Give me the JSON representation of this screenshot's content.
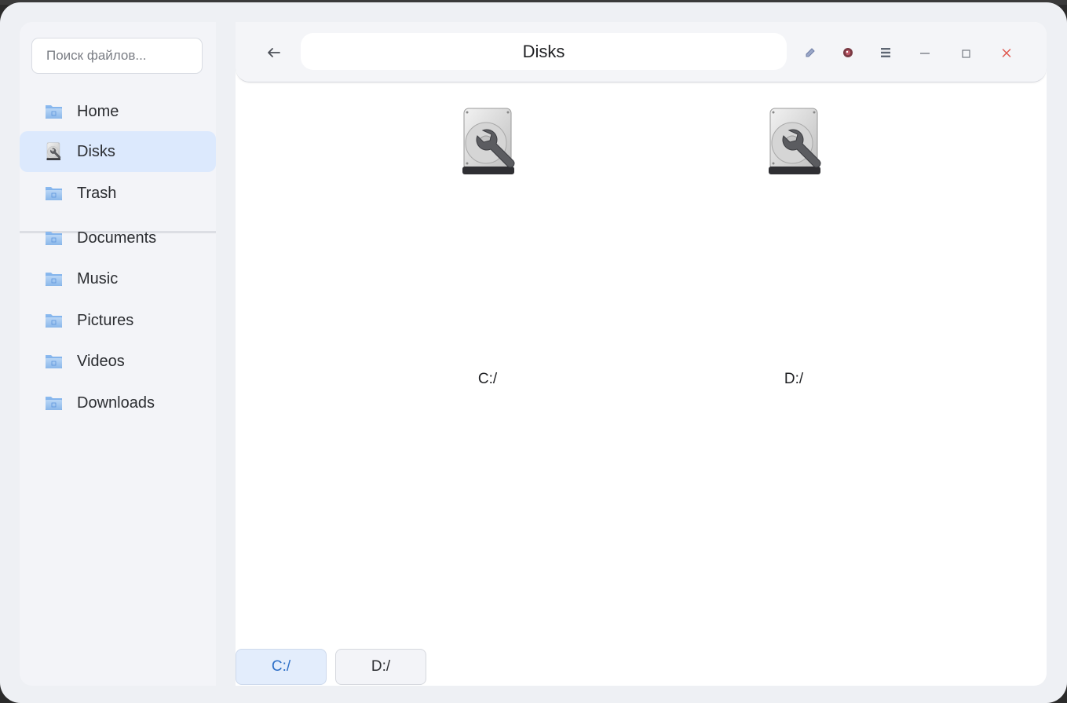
{
  "sidebar": {
    "search_placeholder": "Поиск файлов...",
    "items": [
      {
        "label": "Home",
        "icon": "folder-icon"
      },
      {
        "label": "Disks",
        "icon": "disk-utility-icon",
        "active": true
      },
      {
        "label": "Trash",
        "icon": "folder-icon"
      }
    ],
    "user_items": [
      {
        "label": "Documents",
        "icon": "folder-icon"
      },
      {
        "label": "Music",
        "icon": "folder-icon"
      },
      {
        "label": "Pictures",
        "icon": "folder-icon"
      },
      {
        "label": "Videos",
        "icon": "folder-icon"
      },
      {
        "label": "Downloads",
        "icon": "folder-icon"
      }
    ]
  },
  "header": {
    "back_icon": "arrow-left-icon",
    "title": "Disks",
    "actions": [
      "pencil-icon",
      "eye-icon",
      "menu-icon",
      "minimize-icon",
      "maximize-icon",
      "close-icon"
    ]
  },
  "disks": [
    {
      "label": "C:/",
      "icon": "disk-utility-icon"
    },
    {
      "label": "D:/",
      "icon": "disk-utility-icon"
    }
  ],
  "tabs": [
    {
      "label": "C:/",
      "active": true
    },
    {
      "label": "D:/",
      "active": false
    }
  ],
  "colors": {
    "accent": "#2d6fc7",
    "active_bg": "#dce9fd",
    "close": "#e0564d"
  }
}
